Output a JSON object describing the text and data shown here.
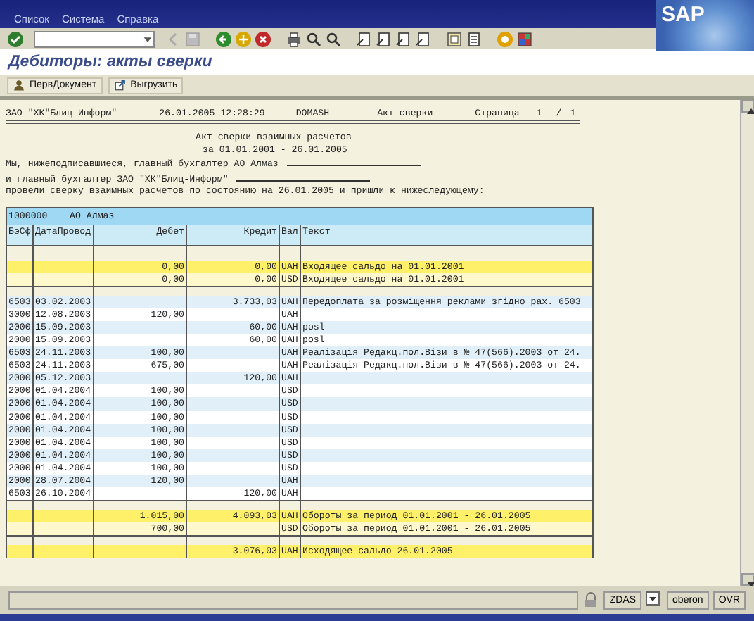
{
  "menu": [
    "Список",
    "Система",
    "Справка"
  ],
  "logo": "SAP",
  "title": "Дебиторы: акты сверки",
  "app_toolbar": [
    "ПервДокумент",
    "Выгрузить"
  ],
  "report": {
    "header": [
      "ЗАО \"ХК\"Блиц-Информ\"",
      "26.01.2005 12:28:29",
      "DOMASH",
      "Акт сверки",
      "Страница",
      "1",
      "/",
      "1"
    ],
    "heading": [
      "Акт сверки взаимных расчетов",
      "за 01.01.2001 - 26.01.2005"
    ],
    "intro": [
      {
        "text": "Мы, нижеподписавшиеся, главный бухгалтер АО Алмаз",
        "blank": true
      },
      {
        "text": "и главный бухгалтер ЗАО \"ХК\"Блиц-Информ\"",
        "blank": true
      },
      {
        "text": "провели сверку взаимных расчетов по состоянию на 26.01.2005 и пришли к нижеследующему:",
        "blank": false
      }
    ]
  },
  "table": {
    "customer": {
      "number": "1000000",
      "name": "АО Алмаз"
    },
    "columns": [
      "БэСф",
      "ДатаПровод",
      "Дебет",
      "Кредит",
      "Вал",
      "Текст"
    ],
    "opening": [
      {
        "debit": "0,00",
        "credit": "0,00",
        "currency": "UAH",
        "text": "Входящее сальдо на 01.01.2001"
      },
      {
        "debit": "0,00",
        "credit": "0,00",
        "currency": "USD",
        "text": "Входящее сальдо на 01.01.2001"
      }
    ],
    "rows": [
      {
        "code": "6503",
        "date": "03.02.2003",
        "credit": "3.733,03",
        "currency": "UAH",
        "text": "Передоплата за розміщення реклами згідно рах. 6503"
      },
      {
        "code": "3000",
        "date": "12.08.2003",
        "debit": "120,00",
        "currency": "UAH"
      },
      {
        "code": "2000",
        "date": "15.09.2003",
        "credit": "60,00",
        "currency": "UAH",
        "text": "posl"
      },
      {
        "code": "2000",
        "date": "15.09.2003",
        "credit": "60,00",
        "currency": "UAH",
        "text": "posl"
      },
      {
        "code": "6503",
        "date": "24.11.2003",
        "debit": "100,00",
        "currency": "UAH",
        "text": "Реалізація Редакц.пол.Візи в № 47(566).2003 от 24."
      },
      {
        "code": "6503",
        "date": "24.11.2003",
        "debit": "675,00",
        "currency": "UAH",
        "text": "Реалізація Редакц.пол.Візи в № 47(566).2003 от 24."
      },
      {
        "code": "2000",
        "date": "05.12.2003",
        "credit": "120,00",
        "currency": "UAH"
      },
      {
        "code": "2000",
        "date": "01.04.2004",
        "debit": "100,00",
        "currency": "USD"
      },
      {
        "code": "2000",
        "date": "01.04.2004",
        "debit": "100,00",
        "currency": "USD"
      },
      {
        "code": "2000",
        "date": "01.04.2004",
        "debit": "100,00",
        "currency": "USD"
      },
      {
        "code": "2000",
        "date": "01.04.2004",
        "debit": "100,00",
        "currency": "USD"
      },
      {
        "code": "2000",
        "date": "01.04.2004",
        "debit": "100,00",
        "currency": "USD"
      },
      {
        "code": "2000",
        "date": "01.04.2004",
        "debit": "100,00",
        "currency": "USD"
      },
      {
        "code": "2000",
        "date": "01.04.2004",
        "debit": "100,00",
        "currency": "USD"
      },
      {
        "code": "2000",
        "date": "28.07.2004",
        "debit": "120,00",
        "currency": "UAH"
      },
      {
        "code": "6503",
        "date": "26.10.2004",
        "credit": "120,00",
        "currency": "UAH"
      }
    ],
    "turnover": [
      {
        "debit": "1.015,00",
        "credit": "4.093,03",
        "currency": "UAH",
        "text": "Обороты за период 01.01.2001 - 26.01.2005"
      },
      {
        "debit": "700,00",
        "currency": "USD",
        "text": "Обороты за период 01.01.2001 - 26.01.2005"
      }
    ],
    "closing": [
      {
        "credit": "3.076,03",
        "currency": "UAH",
        "text": "Исходящее сальдо 26.01.2005"
      }
    ]
  },
  "status_bar": {
    "fields": [
      "ZDAS",
      "oberon",
      "OVR"
    ]
  }
}
